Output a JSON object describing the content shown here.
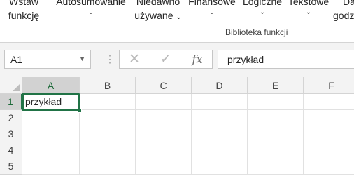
{
  "ribbon": {
    "buttons": [
      {
        "name": "insert-function-button",
        "line1": "Wstaw",
        "line2": "funkcję",
        "chevron": ""
      },
      {
        "name": "autosum-button",
        "line1": "Autosumowanie",
        "line2": "",
        "chevron": "⌄"
      },
      {
        "name": "recently-used-button",
        "line1": "Niedawno",
        "line2": "używane",
        "chevron": "⌄"
      },
      {
        "name": "financial-button",
        "line1": "Finansowe",
        "line2": "",
        "chevron": "⌄"
      },
      {
        "name": "logical-button",
        "line1": "Logiczne",
        "line2": "",
        "chevron": "⌄"
      },
      {
        "name": "text-button",
        "line1": "Tekstowe",
        "line2": "",
        "chevron": "⌄"
      },
      {
        "name": "date-time-button",
        "line1": "Da",
        "line2": "godz",
        "chevron": ""
      }
    ],
    "group_label": "Biblioteka funkcji"
  },
  "formula_bar": {
    "name_box": "A1",
    "cancel_icon": "✕",
    "enter_icon": "✓",
    "fx_icon": "fx",
    "formula": "przykład"
  },
  "grid": {
    "columns": [
      "A",
      "B",
      "C",
      "D",
      "E",
      "F"
    ],
    "rows": [
      "1",
      "2",
      "3",
      "4",
      "5"
    ],
    "selected_cell": "A1",
    "cells": {
      "A1": "przykład"
    }
  },
  "colors": {
    "accent": "#217346"
  }
}
